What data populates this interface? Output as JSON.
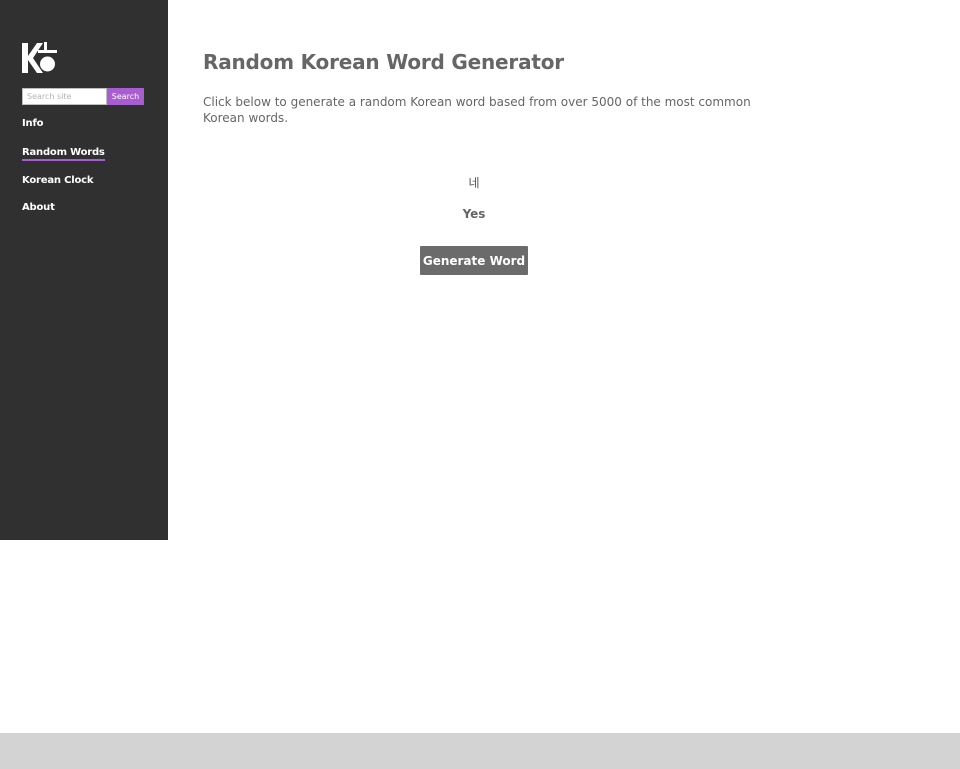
{
  "sidebar": {
    "logo_icon": "korean-ko-logo-icon",
    "search": {
      "placeholder": "Search site",
      "value": "",
      "button_label": "Search"
    },
    "nav": [
      {
        "label": "Info",
        "active": false
      },
      {
        "label": "Random Words",
        "active": true
      },
      {
        "label": "Korean Clock",
        "active": false
      },
      {
        "label": "About",
        "active": false
      }
    ]
  },
  "main": {
    "title": "Random Korean Word Generator",
    "intro": "Click below to generate a random Korean word based from over 5000 of the most common Korean words.",
    "word": {
      "korean": "네",
      "english": "Yes"
    },
    "generate_label": "Generate Word"
  },
  "colors": {
    "sidebar_bg": "#303030",
    "accent": "#a85ed1",
    "button_bg": "#6b6b6b",
    "footer_bg": "#d3d3d3",
    "text": "#666666"
  }
}
